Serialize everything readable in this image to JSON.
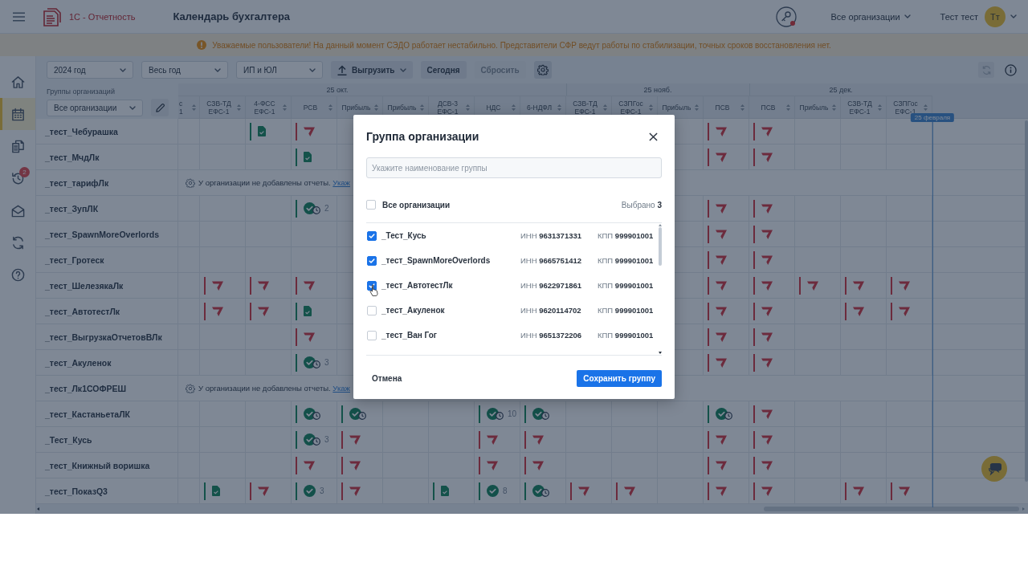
{
  "app_bar": {
    "brand": "1С - Отчетность",
    "title": "Календарь бухгалтера",
    "org_selector": "Все организации",
    "user_name": "Тест тест",
    "avatar_initials": "Тт"
  },
  "notice": "Уважаемые пользователи! На данный момент СЭДО работает нестабильно. Представители СФР ведут работы по стабилизации, точных сроков восстановления нет.",
  "sidebar": {
    "items": [
      {
        "kind": "home",
        "selected": false
      },
      {
        "kind": "calendar",
        "selected": true
      },
      {
        "kind": "documents",
        "selected": false
      },
      {
        "kind": "history",
        "selected": false,
        "badge": "2"
      },
      {
        "kind": "mail",
        "selected": false
      },
      {
        "kind": "sync",
        "selected": false
      },
      {
        "kind": "help",
        "selected": false
      }
    ]
  },
  "toolbar": {
    "filters": [
      "2024 год",
      "Весь год",
      "ИП и ЮЛ"
    ],
    "buttons": [
      {
        "kind": "export",
        "label": "Выгрузить",
        "disabled": false
      },
      {
        "kind": "text",
        "label": "Сегодня",
        "disabled": false
      },
      {
        "kind": "text",
        "label": "Сбросить",
        "disabled": true
      },
      {
        "kind": "settings",
        "disabled": false
      }
    ],
    "tools": [
      {
        "kind": "refresh",
        "disabled": true
      },
      {
        "kind": "info",
        "disabled": false
      }
    ]
  },
  "groups_panel": {
    "label": "Группы организаций",
    "selector": "Все организации"
  },
  "calendar": {
    "periods": [
      {
        "columns": [
          {
            "lines": [
              "с",
              "1"
            ],
            "clipped": true
          },
          {
            "lines": [
              "СЗВ-ТД",
              "ЕФС-1"
            ],
            "clipped": false
          },
          {
            "lines": [
              "4-ФСС",
              "ЕФС-1"
            ],
            "clipped": false
          },
          {
            "lines": [
              "РСВ"
            ],
            "clipped": false
          },
          {
            "lines": [
              "Прибыль"
            ],
            "clipped": false,
            "date": "25 окт."
          },
          {
            "lines": [
              "Прибыль"
            ],
            "clipped": false
          },
          {
            "lines": [
              "ДСВ-3",
              "ЕФС-1"
            ],
            "clipped": false
          },
          {
            "lines": [
              "НДС"
            ],
            "clipped": false
          },
          {
            "lines": [
              "6-НДФЛ"
            ],
            "clipped": false
          }
        ]
      },
      {
        "columns": [
          {
            "lines": [
              "СЗВ-ТД",
              "ЕФС-1"
            ],
            "clipped": false
          },
          {
            "lines": [
              "СЗПГос",
              "ЕФС-1"
            ],
            "clipped": false
          },
          {
            "lines": [
              "Прибыль"
            ],
            "clipped": false,
            "date": "25 нояб."
          },
          {
            "lines": [
              "ПСВ"
            ],
            "clipped": false
          }
        ]
      },
      {
        "columns": [
          {
            "lines": [
              "ПСВ"
            ],
            "clipped": false
          },
          {
            "lines": [
              "Прибыль"
            ],
            "clipped": false
          },
          {
            "lines": [
              "СЗВ-ТД",
              "ЕФС-1"
            ],
            "clipped": false,
            "date": "25 дек."
          },
          {
            "lines": [
              "СЗПГос",
              "ЕФС-1"
            ],
            "clipped": false
          }
        ]
      }
    ],
    "today_marker": "25 февраля",
    "rows": [
      {
        "kind": "reports",
        "name": "_тест_Чебурашка",
        "cells": [
          null,
          null,
          {
            "kind": "doc"
          },
          {
            "kind": "flag"
          },
          null,
          null,
          null,
          null,
          null,
          null,
          null,
          null,
          {
            "kind": "flag"
          },
          {
            "kind": "flag"
          },
          null,
          null,
          null
        ]
      },
      {
        "kind": "reports",
        "name": "_тест_МчдЛк",
        "cells": [
          null,
          null,
          null,
          {
            "kind": "doc"
          },
          null,
          null,
          null,
          null,
          null,
          null,
          null,
          null,
          {
            "kind": "flag"
          },
          {
            "kind": "flag"
          },
          null,
          null,
          null
        ]
      },
      {
        "kind": "notice",
        "name": "_тест_тарифЛк",
        "message": "У организации не добавлены отчеты.",
        "link": "Укаж"
      },
      {
        "kind": "reports",
        "name": "_тест_ЗупЛК",
        "cells": [
          null,
          null,
          null,
          {
            "kind": "check",
            "clock": true,
            "count": "2"
          },
          null,
          null,
          null,
          null,
          null,
          null,
          null,
          null,
          {
            "kind": "flag"
          },
          {
            "kind": "flag"
          },
          null,
          null,
          null
        ]
      },
      {
        "kind": "reports",
        "name": "_тест_SpawnMoreOverlords",
        "cells": [
          null,
          null,
          null,
          null,
          null,
          null,
          null,
          null,
          null,
          null,
          null,
          null,
          {
            "kind": "flag"
          },
          {
            "kind": "flag"
          },
          null,
          null,
          null
        ]
      },
      {
        "kind": "reports",
        "name": "_тест_Гротеск",
        "cells": [
          null,
          null,
          null,
          null,
          null,
          null,
          null,
          null,
          null,
          null,
          null,
          null,
          {
            "kind": "flag"
          },
          {
            "kind": "flag"
          },
          null,
          null,
          null
        ]
      },
      {
        "kind": "reports",
        "name": "_тест_ШелезякаЛк",
        "cells": [
          null,
          {
            "kind": "flag"
          },
          {
            "kind": "flag"
          },
          {
            "kind": "flag"
          },
          null,
          null,
          null,
          null,
          null,
          null,
          null,
          null,
          {
            "kind": "flag"
          },
          {
            "kind": "flag"
          },
          {
            "kind": "flag"
          },
          {
            "kind": "flag"
          },
          {
            "kind": "flag"
          }
        ]
      },
      {
        "kind": "reports",
        "name": "_тест_АвтотестЛк",
        "cells": [
          null,
          {
            "kind": "flag"
          },
          {
            "kind": "flag"
          },
          {
            "kind": "doc"
          },
          null,
          null,
          null,
          null,
          null,
          null,
          null,
          null,
          {
            "kind": "flag"
          },
          {
            "kind": "flag"
          },
          null,
          {
            "kind": "flag"
          },
          {
            "kind": "flag"
          }
        ]
      },
      {
        "kind": "reports",
        "name": "_тест_ВыгрузкаОтчетовВЛк",
        "cells": [
          null,
          null,
          null,
          {
            "kind": "flag"
          },
          null,
          null,
          null,
          null,
          null,
          null,
          null,
          null,
          {
            "kind": "flag"
          },
          {
            "kind": "flag"
          },
          null,
          null,
          null
        ]
      },
      {
        "kind": "reports",
        "name": "_тест_Акуленок",
        "cells": [
          null,
          null,
          null,
          {
            "kind": "check",
            "clock": true,
            "count": "3"
          },
          null,
          null,
          null,
          null,
          null,
          null,
          null,
          null,
          {
            "kind": "flag"
          },
          {
            "kind": "flag"
          },
          null,
          null,
          null
        ]
      },
      {
        "kind": "notice",
        "name": "_тест_Лк1СОФРЕШ",
        "message": "У организации не добавлены отчеты.",
        "link": "Укаж"
      },
      {
        "kind": "reports",
        "name": "_тест_КастаньетаЛК",
        "cells": [
          null,
          null,
          null,
          {
            "kind": "check",
            "clock": true
          },
          {
            "kind": "check",
            "clock": true
          },
          null,
          null,
          {
            "kind": "check",
            "clock": true,
            "count": "10"
          },
          {
            "kind": "check",
            "clock": true
          },
          null,
          null,
          null,
          {
            "kind": "check",
            "clock": true
          },
          {
            "kind": "flag"
          },
          null,
          null,
          null
        ]
      },
      {
        "kind": "reports",
        "name": "_Тест_Кусь",
        "cells": [
          null,
          null,
          null,
          {
            "kind": "check",
            "clock": true,
            "count": "3"
          },
          {
            "kind": "flag"
          },
          null,
          null,
          {
            "kind": "flag"
          },
          {
            "kind": "flag"
          },
          null,
          null,
          null,
          {
            "kind": "flag"
          },
          {
            "kind": "flag"
          },
          null,
          null,
          null
        ]
      },
      {
        "kind": "reports",
        "name": "_тест_Книжный воришка",
        "cells": [
          null,
          null,
          null,
          {
            "kind": "flag"
          },
          {
            "kind": "flag"
          },
          null,
          null,
          {
            "kind": "flag"
          },
          {
            "kind": "flag"
          },
          null,
          null,
          null,
          {
            "kind": "flag"
          },
          {
            "kind": "flag"
          },
          null,
          null,
          null
        ]
      },
      {
        "kind": "reports",
        "name": "_тест_ПоказQ3",
        "cells": [
          null,
          {
            "kind": "doc"
          },
          {
            "kind": "flag"
          },
          {
            "kind": "check",
            "clock": false,
            "count": "3"
          },
          {
            "kind": "flag"
          },
          null,
          {
            "kind": "doc"
          },
          {
            "kind": "check",
            "clock": false,
            "count": "8"
          },
          {
            "kind": "check",
            "clock": true
          },
          {
            "kind": "flag"
          },
          {
            "kind": "flag"
          },
          null,
          {
            "kind": "flag"
          },
          {
            "kind": "flag"
          },
          null,
          {
            "kind": "flag"
          },
          {
            "kind": "flag"
          }
        ]
      }
    ]
  },
  "modal": {
    "title": "Группа организации",
    "name_field": {
      "placeholder": "Укажите наименование группы"
    },
    "select_all": {
      "label": "Все организации",
      "checked": false
    },
    "selected_count": "Выбрано **3**",
    "organizations": [
      {
        "name": "_Тест_Кусь",
        "inn": "ИНН **9631371331**",
        "kpp": "КПП **999901001**",
        "checked": true
      },
      {
        "name": "_тест_SpawnMoreOverlords",
        "inn": "ИНН **9665751412**",
        "kpp": "КПП **999901001**",
        "checked": true
      },
      {
        "name": "_тест_АвтотестЛк",
        "inn": "ИНН **9622971861**",
        "kpp": "КПП **999901001**",
        "checked": true
      },
      {
        "name": "_тест_Акуленок",
        "inn": "ИНН **9620114702**",
        "kpp": "КПП **999901001**",
        "checked": false
      },
      {
        "name": "_тест_Ван Гог",
        "inn": "ИНН **9651372206**",
        "kpp": "КПП **999901001**",
        "checked": false
      }
    ],
    "cancel_button": "Отмена",
    "save_button": "Сохранить группу"
  }
}
